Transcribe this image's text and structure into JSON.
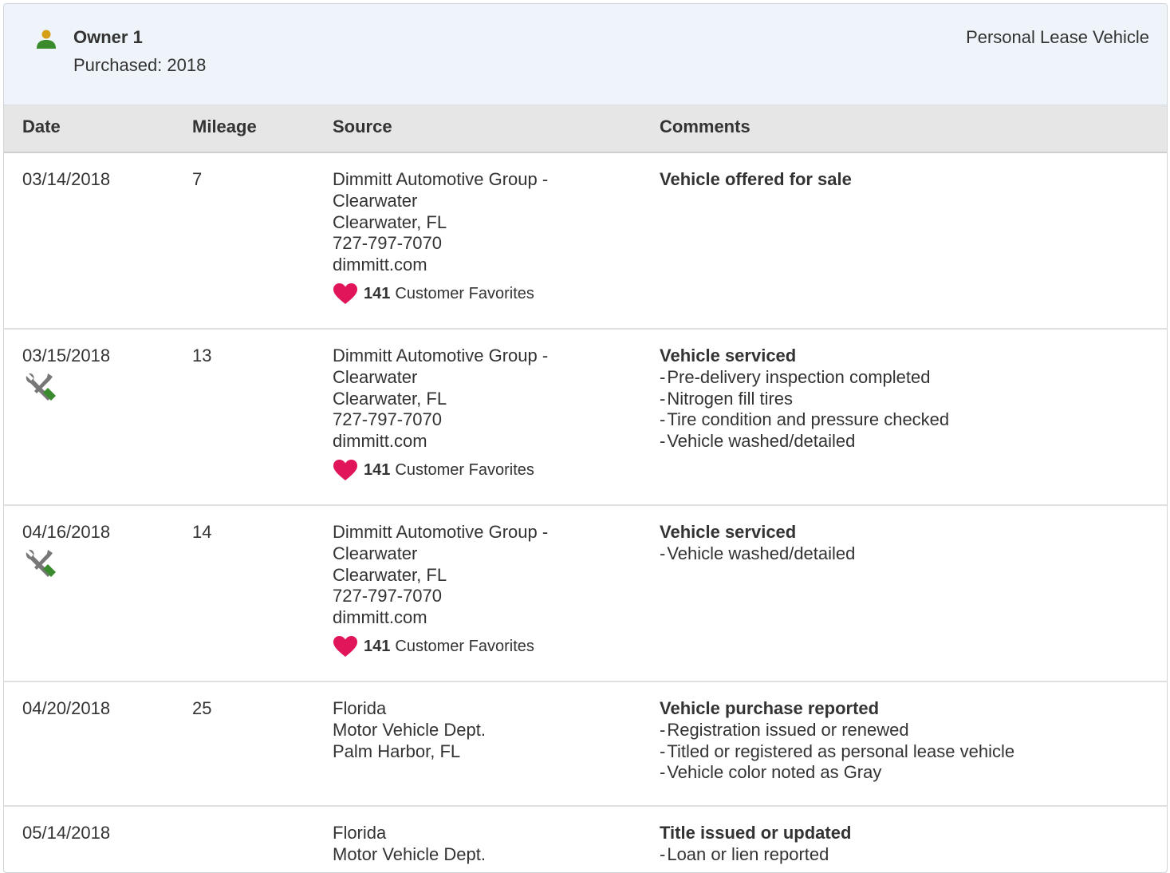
{
  "owner": {
    "name": "Owner 1",
    "purchased": "Purchased: 2018",
    "type": "Personal Lease Vehicle",
    "icon": "person-icon",
    "icon_color": "#3a8a2e",
    "icon_head_color": "#d4a017"
  },
  "columns": {
    "date": "Date",
    "mileage": "Mileage",
    "source": "Source",
    "comments": "Comments"
  },
  "records": [
    {
      "date": "03/14/2018",
      "mileage": "7",
      "service": false,
      "source": [
        "Dimmitt Automotive Group -",
        "Clearwater",
        "Clearwater, FL",
        "727-797-7070",
        "dimmitt.com"
      ],
      "favorites": {
        "count": "141",
        "label": "Customer Favorites"
      },
      "comment_title": "Vehicle offered for sale",
      "comment_items": []
    },
    {
      "date": "03/15/2018",
      "mileage": "13",
      "service": true,
      "source": [
        "Dimmitt Automotive Group -",
        "Clearwater",
        "Clearwater, FL",
        "727-797-7070",
        "dimmitt.com"
      ],
      "favorites": {
        "count": "141",
        "label": "Customer Favorites"
      },
      "comment_title": "Vehicle serviced",
      "comment_items": [
        "Pre-delivery inspection completed",
        "Nitrogen fill tires",
        "Tire condition and pressure checked",
        "Vehicle washed/detailed"
      ]
    },
    {
      "date": "04/16/2018",
      "mileage": "14",
      "service": true,
      "source": [
        "Dimmitt Automotive Group -",
        "Clearwater",
        "Clearwater, FL",
        "727-797-7070",
        "dimmitt.com"
      ],
      "favorites": {
        "count": "141",
        "label": "Customer Favorites"
      },
      "comment_title": "Vehicle serviced",
      "comment_items": [
        "Vehicle washed/detailed"
      ]
    },
    {
      "date": "04/20/2018",
      "mileage": "25",
      "service": false,
      "source": [
        "Florida",
        "Motor Vehicle Dept.",
        "Palm Harbor, FL"
      ],
      "favorites": null,
      "comment_title": "Vehicle purchase reported",
      "comment_items": [
        "Registration issued or renewed",
        "Titled or registered as personal lease vehicle",
        "Vehicle color noted as Gray"
      ]
    },
    {
      "date": "05/14/2018",
      "mileage": "",
      "service": false,
      "source": [
        "Florida",
        "Motor Vehicle Dept."
      ],
      "favorites": null,
      "comment_title": "Title issued or updated",
      "comment_items": [
        "Loan or lien reported"
      ]
    }
  ],
  "colors": {
    "heart": "#e0155a",
    "wrench": "#777777",
    "screwdriver_handle": "#3a8a2e",
    "header_bg": "#eef4f9",
    "column_header_bg": "#e6e6e6"
  }
}
